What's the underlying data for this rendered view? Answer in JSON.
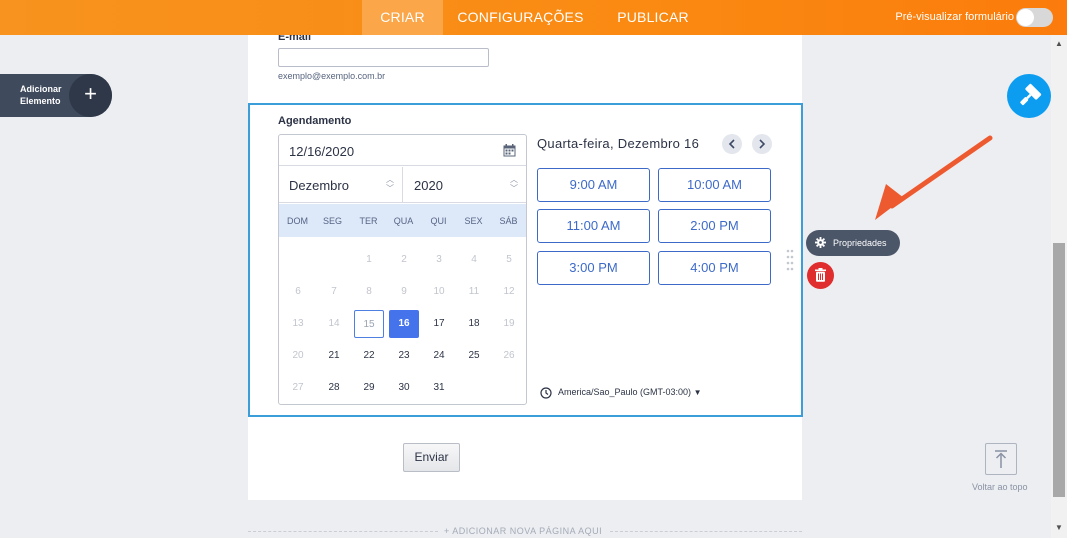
{
  "topbar": {
    "tabs": [
      {
        "label": "CRIAR",
        "active": true
      },
      {
        "label": "CONFIGURAÇÕES",
        "active": false
      },
      {
        "label": "PUBLICAR",
        "active": false
      }
    ],
    "preview_label": "Pré-visualizar formulário",
    "preview_enabled": false
  },
  "sidebar": {
    "add_element_line1": "Adicionar",
    "add_element_line2": "Elemento"
  },
  "email": {
    "label": "E-mail",
    "value": "",
    "sublabel": "exemplo@exemplo.com.br"
  },
  "appointment": {
    "label": "Agendamento",
    "date_value": "12/16/2020",
    "month": "Dezembro",
    "year": "2020",
    "weekdays": [
      "DOM",
      "SEG",
      "TER",
      "QUA",
      "QUI",
      "SEX",
      "SÁB"
    ],
    "days": [
      [
        null,
        null,
        "1",
        "2",
        "3",
        "4",
        "5"
      ],
      [
        "6",
        "7",
        "8",
        "9",
        "10",
        "11",
        "12"
      ],
      [
        "13",
        "14",
        "15",
        "16",
        "17",
        "18",
        "19"
      ],
      [
        "20",
        "21",
        "22",
        "23",
        "24",
        "25",
        "26"
      ],
      [
        "27",
        "28",
        "29",
        "30",
        "31",
        null,
        null
      ]
    ],
    "today": "15",
    "selected": "16",
    "date_heading": "Quarta-feira, Dezembro 16",
    "slots": [
      "9:00 AM",
      "10:00 AM",
      "11:00 AM",
      "2:00 PM",
      "3:00 PM",
      "4:00 PM"
    ],
    "timezone": "America/Sao_Paulo (GMT-03:00)"
  },
  "submit_label": "Enviar",
  "add_page_label": "+ ADICIONAR NOVA PÁGINA AQUI",
  "properties_label": "Propriedades",
  "back_to_top_label": "Voltar ao topo",
  "colors": {
    "accent": "#f7931e",
    "selected_day": "#4573ec",
    "slot": "#3d6ac9",
    "delete": "#e02d2d",
    "paint": "#0c9cf0",
    "arrow": "#ee5a2f"
  }
}
